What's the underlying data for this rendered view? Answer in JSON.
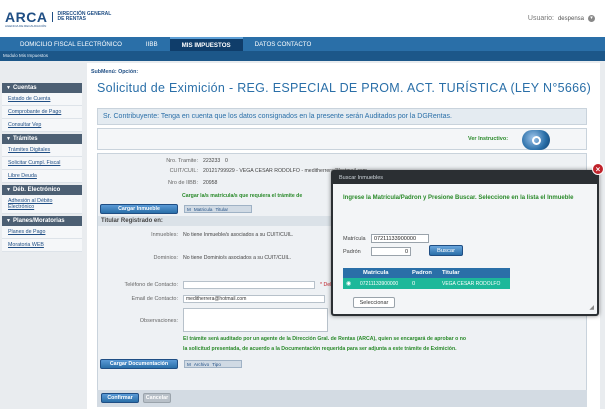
{
  "header": {
    "logo": "ARCA",
    "logo_subtitle": "AGENCIA DE RECAUDACIÓN",
    "logo_text_1": "DIRECCIÓN GENERAL",
    "logo_text_2": "DE RENTAS",
    "user_label": "Usuario:",
    "username": "despensa"
  },
  "nav": {
    "tabs": [
      {
        "label": "DOMICILIO FISCAL ELECTRÓNICO"
      },
      {
        "label": "IIBB"
      },
      {
        "label": "MIS IMPUESTOS"
      },
      {
        "label": "DATOS CONTACTO"
      }
    ],
    "breadcrumb": "Modulo Mis Impuestos"
  },
  "sidebar": {
    "sections": [
      {
        "title": "Cuentas",
        "items": [
          "Estado de Cuenta",
          "Comprobante de Pago",
          "Consultar Vep"
        ]
      },
      {
        "title": "Trámites",
        "items": [
          "Trámites Digitales",
          "Solicitar Cumpl. Fiscal",
          "Libre Deuda"
        ]
      },
      {
        "title": "Déb. Electrónico",
        "items": [
          "Adhesión al Débito Electrónico"
        ]
      },
      {
        "title": "Planes/Moratorias",
        "items": [
          "Planes de Pago",
          "Moratoria WEB"
        ]
      }
    ]
  },
  "main": {
    "submenu": "SubMenú: Opción:",
    "title": "Solicitud de Eximición - REG. ESPECIAL DE PROM. ACT. TURÍSTICA (LEY N°5666)",
    "notice": "Sr. Contribuyente: Tenga en cuenta que los datos consignados en la presente serán Auditados por la DGRentas.",
    "instructivo": "Ver Instructivo:",
    "nro_tramite_label": "Nro. Tramite:",
    "nro_tramite": "223233",
    "nro_tramite_2": "0",
    "cuit_label": "CUIT/CUIL:",
    "cuit": "20121799929 - VEGA CESAR RODOLFO - meditherrera@hotmail.com",
    "iibb_label": "Nro de IIBB:",
    "iibb": "20958",
    "cargar_inmueble": "Cargar Inmueble",
    "cargar_hint": "Cargar la/s matrícula/s que requiera el trámite de",
    "mini_table_1": [
      "M",
      "Matricula",
      "Titular"
    ],
    "titular_section": "Titular Registrado en:",
    "inmuebles_label": "Inmuebles:",
    "inmuebles_val": "No tiene Inmueble/s asociados a su CUIT/CUIL.",
    "dominios_label": "Dominios:",
    "dominios_val": "No tiene Dominio/s asociados a su CUIT/CUIL.",
    "telefono_label": "Teléfono de Contacto:",
    "telefono_star": "* Del",
    "email_label": "Email de Contacto:",
    "email_val": "meditherrera@hotmail.com",
    "observaciones_label": "Observaciones:",
    "auditoria_text_1": "El trámite será auditado por un agente de la Dirección Gral. de Rentas (ARCA), quien se encargará de aprobar o no",
    "auditoria_text_2": "la solicitud presentada, de acuerdo a la Documentación requerida para ser adjunta a este trámite de Eximición.",
    "cargar_doc": "Cargar Documentación",
    "mini_table_2": [
      "M",
      "Archivo",
      "Tipo"
    ],
    "confirmar": "Confirmar",
    "cancelar": "Cancelar"
  },
  "modal": {
    "title": "Buscar Inmuebles",
    "message": "Ingrese la Matrícula/Padron y Presione Buscar. Seleccione en la lista el Inmueble",
    "matricula_label": "Matrícula",
    "matricula_value": "07211133900000",
    "padron_label": "Padrón",
    "padron_value": "0",
    "buscar": "Buscar",
    "columns": [
      "Matricula",
      "Padron",
      "Titular"
    ],
    "rows": [
      {
        "matricula": "07211133900000",
        "padron": "0",
        "titular": "VEGA CESAR RODOLFO"
      }
    ],
    "seleccionar": "Seleccionar",
    "close": "×"
  }
}
